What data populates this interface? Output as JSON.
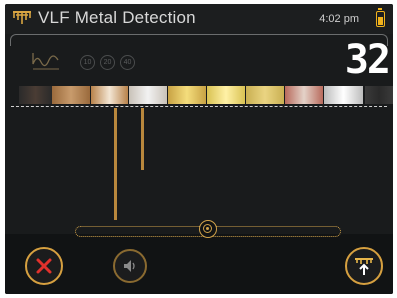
{
  "header": {
    "logo_icon": "pitchfork-logo-icon",
    "title": "VLF Metal Detection",
    "time": "4:02 pm",
    "battery_icon": "battery-icon",
    "battery_level": 0.7
  },
  "frequency": {
    "icon": "waveform-icon",
    "options": [
      "10",
      "20",
      "40"
    ]
  },
  "readout": {
    "value": "32"
  },
  "scale": {
    "icon": "color-scale",
    "segments": [
      {
        "from": "#2a2a2a",
        "to": "#4a3c34"
      },
      {
        "from": "#9a6a3c",
        "to": "#c89b6c"
      },
      {
        "from": "#b8824a",
        "to": "#f3e6d4"
      },
      {
        "from": "#c9c2b8",
        "to": "#f2f2f2"
      },
      {
        "from": "#c8a244",
        "to": "#f4dd7c"
      },
      {
        "from": "#d9c253",
        "to": "#fff1a6"
      },
      {
        "from": "#c9b052",
        "to": "#ead482"
      },
      {
        "from": "#b86a5c",
        "to": "#e4d2c8"
      },
      {
        "from": "#bcbcbc",
        "to": "#ffffff"
      },
      {
        "from": "#3a3a3a",
        "to": "#2a2a2a"
      }
    ]
  },
  "graph": {
    "bars": [
      {
        "position": 0.28,
        "level": 1.0
      },
      {
        "position": 0.35,
        "level": 0.55
      }
    ]
  },
  "slider": {
    "level": 0.5,
    "icon": "target-knob-icon"
  },
  "footer": {
    "close_icon": "close-icon",
    "sound_icon": "speaker-icon",
    "pinpoint_icon": "pinpoint-icon"
  },
  "colors": {
    "accent": "#d6a040",
    "background": "#111314",
    "close_red": "#e0312c"
  }
}
